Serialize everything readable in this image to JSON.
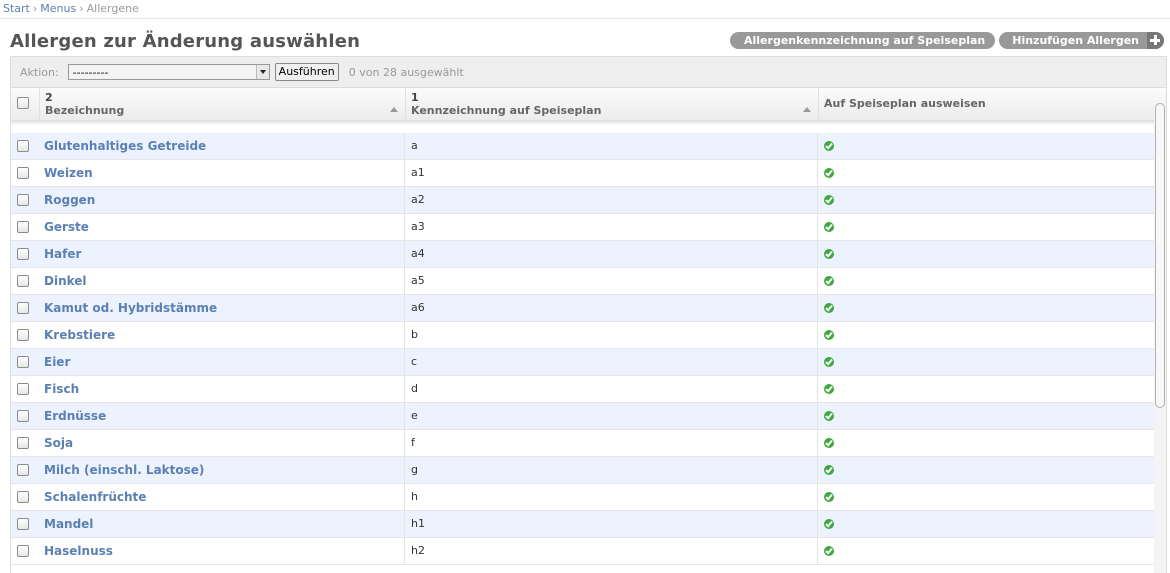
{
  "breadcrumbs": {
    "start": "Start",
    "menus": "Menus",
    "current": "Allergene",
    "separator": "›"
  },
  "page_title": "Allergen zur Änderung auswählen",
  "object_tools": {
    "tool1": "Allergenkennzeichnung auf Speiseplan",
    "tool2": "Hinzufügen Allergen"
  },
  "actions": {
    "label": "Aktion:",
    "selected": "---------",
    "run_button": "Ausführen",
    "counter": "0 von 28 ausgewählt"
  },
  "table": {
    "columns": [
      {
        "priority": "2",
        "title": "Bezeichnung"
      },
      {
        "priority": "1",
        "title": "Kennzeichnung auf Speiseplan"
      },
      {
        "priority": "",
        "title": "Auf Speiseplan ausweisen"
      }
    ],
    "rows": [
      {
        "name": "Glutenhaltiges Getreide",
        "code": "a"
      },
      {
        "name": "Weizen",
        "code": "a1"
      },
      {
        "name": "Roggen",
        "code": "a2"
      },
      {
        "name": "Gerste",
        "code": "a3"
      },
      {
        "name": "Hafer",
        "code": "a4"
      },
      {
        "name": "Dinkel",
        "code": "a5"
      },
      {
        "name": "Kamut od. Hybridstämme",
        "code": "a6"
      },
      {
        "name": "Krebstiere",
        "code": "b"
      },
      {
        "name": "Eier",
        "code": "c"
      },
      {
        "name": "Fisch",
        "code": "d"
      },
      {
        "name": "Erdnüsse",
        "code": "e"
      },
      {
        "name": "Soja",
        "code": "f"
      },
      {
        "name": "Milch (einschl. Laktose)",
        "code": "g"
      },
      {
        "name": "Schalenfrüchte",
        "code": "h"
      },
      {
        "name": "Mandel",
        "code": "h1"
      },
      {
        "name": "Haselnuss",
        "code": "h2"
      }
    ]
  },
  "colors": {
    "link": "#5b80b2",
    "row_alt": "#edf3fe",
    "ok": "#3da83d"
  }
}
